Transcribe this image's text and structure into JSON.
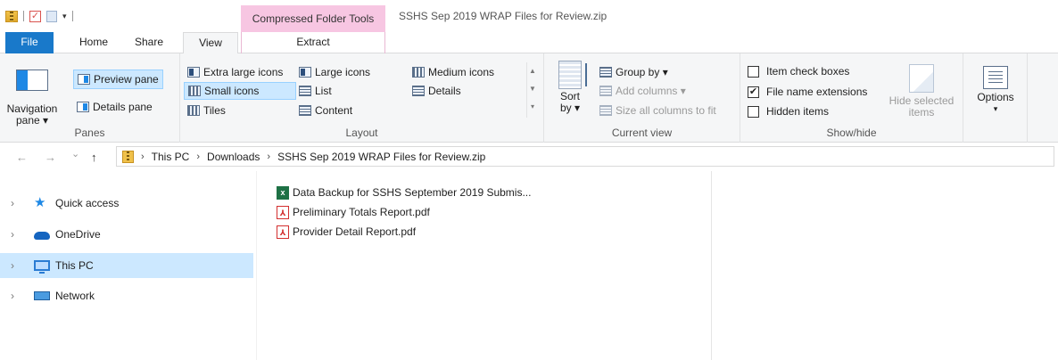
{
  "window": {
    "contextual_tab": "Compressed Folder Tools",
    "title": "SSHS Sep 2019 WRAP Files for Review.zip"
  },
  "tabs": {
    "file": "File",
    "home": "Home",
    "share": "Share",
    "view": "View",
    "extract": "Extract"
  },
  "ribbon": {
    "panes": {
      "label": "Panes",
      "navigation_pane": "Navigation pane",
      "navigation_pane_line1": "Navigation",
      "navigation_pane_line2": "pane ▾",
      "preview_pane": "Preview pane",
      "details_pane": "Details pane"
    },
    "layout": {
      "label": "Layout",
      "extra_large_icons": "Extra large icons",
      "large_icons": "Large icons",
      "medium_icons": "Medium icons",
      "small_icons": "Small icons",
      "list": "List",
      "details": "Details",
      "tiles": "Tiles",
      "content": "Content",
      "selected": "Small icons"
    },
    "current_view": {
      "label": "Current view",
      "sort_by_line1": "Sort",
      "sort_by_line2": "by ▾",
      "group_by": "Group by ▾",
      "add_columns": "Add columns ▾",
      "size_all_columns": "Size all columns to fit"
    },
    "show_hide": {
      "label": "Show/hide",
      "item_check_boxes": "Item check boxes",
      "item_check_boxes_checked": false,
      "file_name_extensions": "File name extensions",
      "file_name_extensions_checked": true,
      "hidden_items": "Hidden items",
      "hidden_items_checked": false,
      "hide_selected_line1": "Hide selected",
      "hide_selected_line2": "items"
    },
    "options": {
      "label": "Options",
      "arrow": "▾"
    }
  },
  "address": {
    "back": "←",
    "forward": "→",
    "recent": "⌄",
    "up": "↑",
    "crumbs": [
      "This PC",
      "Downloads",
      "SSHS Sep 2019 WRAP Files for Review.zip"
    ],
    "separator": "›"
  },
  "nav": {
    "items": [
      {
        "label": "Quick access",
        "icon": "star-icon",
        "selected": false
      },
      {
        "label": "OneDrive",
        "icon": "cloud-icon",
        "selected": false
      },
      {
        "label": "This PC",
        "icon": "computer-icon",
        "selected": true
      },
      {
        "label": "Network",
        "icon": "network-icon",
        "selected": false
      }
    ],
    "chevron": "›"
  },
  "files": [
    {
      "name": "Data Backup for SSHS September 2019 Submis...",
      "type": "xlsx",
      "icon": "excel-icon",
      "icon_glyph": "x"
    },
    {
      "name": "Preliminary Totals Report.pdf",
      "type": "pdf",
      "icon": "pdf-icon",
      "icon_glyph": "⅄"
    },
    {
      "name": "Provider Detail Report.pdf",
      "type": "pdf",
      "icon": "pdf-icon",
      "icon_glyph": "⅄"
    }
  ],
  "colors": {
    "accent": "#1979ca",
    "selection": "#cce8ff",
    "contextual_tab": "#f7c6e2"
  }
}
